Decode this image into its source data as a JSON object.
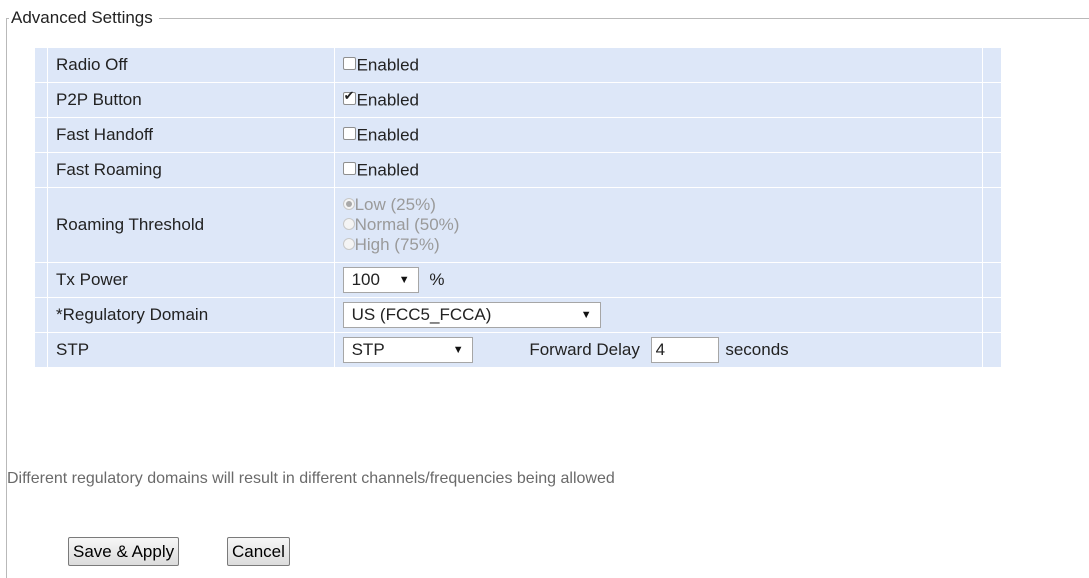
{
  "section": {
    "title": "Advanced Settings"
  },
  "rows": {
    "radio_off": {
      "label": "Radio Off",
      "option": "Enabled",
      "checked": false
    },
    "p2p_button": {
      "label": "P2P Button",
      "option": "Enabled",
      "checked": true
    },
    "fast_handoff": {
      "label": "Fast Handoff",
      "option": "Enabled",
      "checked": false
    },
    "fast_roaming": {
      "label": "Fast Roaming",
      "option": "Enabled",
      "checked": false
    },
    "roaming_threshold": {
      "label": "Roaming Threshold",
      "options": [
        "Low (25%)",
        "Normal (50%)",
        "High (75%)"
      ],
      "selected": "Low (25%)",
      "disabled": true
    },
    "tx_power": {
      "label": "Tx Power",
      "value": "100",
      "unit": "%"
    },
    "regulatory_domain": {
      "label": "*Regulatory Domain",
      "value": "US (FCC5_FCCA)"
    },
    "stp": {
      "label": "STP",
      "value": "STP",
      "forward_delay_label": "Forward Delay",
      "forward_delay_value": "4",
      "forward_delay_unit": "seconds"
    }
  },
  "note": "Different regulatory domains will result in different channels/frequencies being allowed",
  "buttons": {
    "save": "Save & Apply",
    "cancel": "Cancel"
  },
  "icons": {
    "dropdown": "chevron-down-icon",
    "check": "checkmark-icon"
  },
  "colors": {
    "row_bg": "#dde7f8",
    "disabled_text": "#9a9a9a"
  }
}
